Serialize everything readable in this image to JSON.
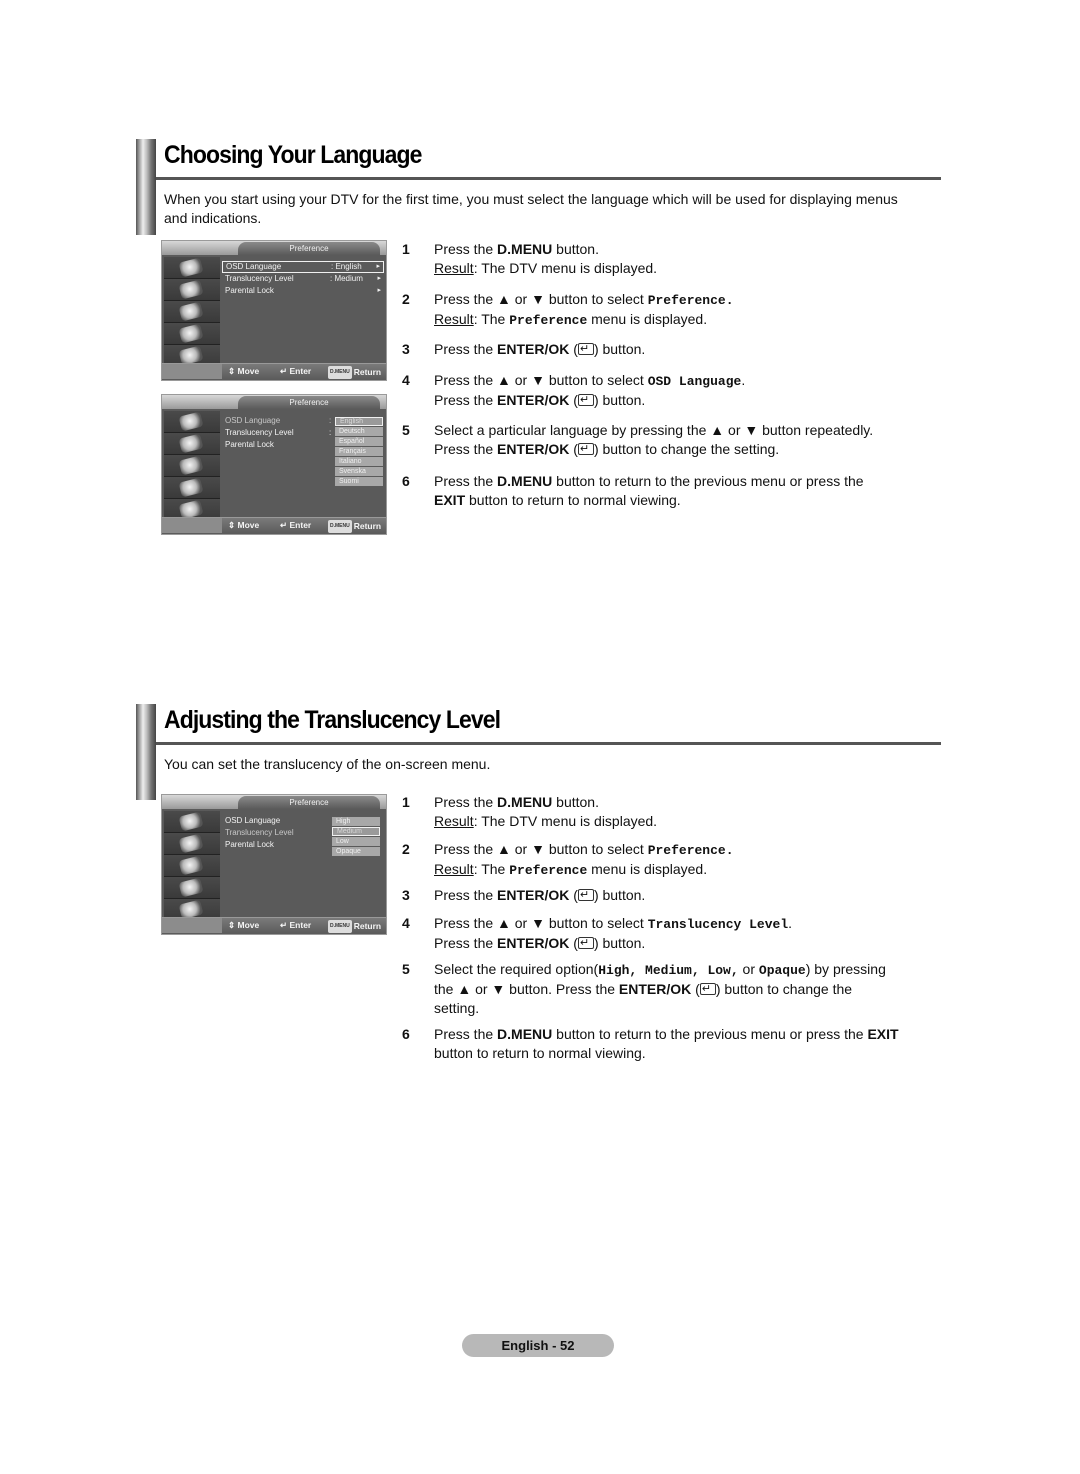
{
  "sections": [
    {
      "title": "Choosing Your Language",
      "intro": "When you start using your DTV for the first time, you must select the language which will be used for displaying menus and indications.",
      "osd_screens": [
        {
          "title": "Preference",
          "items": [
            {
              "label": "OSD Language",
              "value": ": English",
              "arrow": "▸",
              "selected": true
            },
            {
              "label": "Translucency Level",
              "value": ": Medium",
              "arrow": "▸",
              "selected": false
            },
            {
              "label": "Parental Lock",
              "value": "",
              "arrow": "▸",
              "selected": false
            }
          ],
          "footer": {
            "move": "Move",
            "enter": "Enter",
            "dmenu": "D.MENU",
            "return": "Return"
          }
        },
        {
          "title": "Preference",
          "items": [
            {
              "label": "OSD Language",
              "value": ":"
            },
            {
              "label": "Translucency Level",
              "value": ":"
            },
            {
              "label": "Parental Lock",
              "value": ""
            }
          ],
          "popup_options": [
            "English",
            "Deutsch",
            "Español",
            "Français",
            "Italiano",
            "Svenska",
            "Suomi"
          ],
          "popup_current": "English",
          "footer": {
            "move": "Move",
            "enter": "Enter",
            "dmenu": "D.MENU",
            "return": "Return"
          }
        }
      ],
      "steps": [
        {
          "num": "1",
          "l1a": "Press the ",
          "l1b": "D.MENU",
          "l1c": " button.",
          "result_label": "Result",
          "result_text": ":  The DTV menu is displayed."
        },
        {
          "num": "2",
          "l1a": "Press the ▲ or ▼ button to select ",
          "l1b": "Preference.",
          "result_label": "Result",
          "result_a": ":  The ",
          "result_b": "Preference",
          "result_c": " menu is displayed."
        },
        {
          "num": "3",
          "l1a": "Press the ",
          "l1b": "ENTER/OK",
          "l1c": " (",
          "l1d": ") button."
        },
        {
          "num": "4",
          "l1a": "Press the ▲ or ▼ button to select ",
          "l1b": "OSD Language",
          "l1c": ".",
          "l2a": "Press the ",
          "l2b": "ENTER/OK",
          "l2c": " (",
          "l2d": ") button."
        },
        {
          "num": "5",
          "l1a": "Select a particular language by pressing the ▲ or ▼ button repeatedly.",
          "l2a": "Press the ",
          "l2b": "ENTER/OK",
          "l2c": " (",
          "l2d": ") button to change the setting."
        },
        {
          "num": "6",
          "l1a": "Press the ",
          "l1b": "D.MENU",
          "l1c": " button to return to the previous menu or press the",
          "l2b": "EXIT",
          "l2c": " button to return to normal viewing."
        }
      ]
    },
    {
      "title": "Adjusting the Translucency Level",
      "intro": "You can set the translucency of the on-screen menu.",
      "osd_screens": [
        {
          "title": "Preference",
          "items": [
            {
              "label": "OSD Language"
            },
            {
              "label": "Translucency Level"
            },
            {
              "label": "Parental Lock"
            }
          ],
          "popup_options": [
            "High",
            "Medium",
            "Low",
            "Opaque"
          ],
          "popup_current": "Medium",
          "footer": {
            "move": "Move",
            "enter": "Enter",
            "dmenu": "D.MENU",
            "return": "Return"
          }
        }
      ],
      "steps": [
        {
          "num": "1",
          "l1a": "Press the ",
          "l1b": "D.MENU",
          "l1c": " button.",
          "result_label": "Result",
          "result_text": ":  The DTV menu is displayed."
        },
        {
          "num": "2",
          "l1a": "Press the ▲ or ▼ button to select ",
          "l1b": "Preference.",
          "result_label": "Result",
          "result_a": ":  The ",
          "result_b": "Preference",
          "result_c": " menu is displayed."
        },
        {
          "num": "3",
          "l1a": "Press the ",
          "l1b": "ENTER/OK",
          "l1c": " (",
          "l1d": ") button."
        },
        {
          "num": "4",
          "l1a": "Press the ▲ or ▼ button to select ",
          "l1b": "Translucency Level",
          "l1c": ".",
          "l2a": "Press the ",
          "l2b": "ENTER/OK",
          "l2c": " (",
          "l2d": ") button."
        },
        {
          "num": "5",
          "l1a": "Select the required option(",
          "o1": "High,",
          "o2": " Medium,",
          "o3": " Low,",
          "or": " or ",
          "o4": "Opaque",
          "l1c": ") by pressing",
          "l2a": "the ▲ or ▼ button. Press the ",
          "l2b": "ENTER/OK",
          "l2c": " (",
          "l2d": ") button to change the",
          "l3": "setting."
        },
        {
          "num": "6",
          "l1a": "Press the ",
          "l1b": "D.MENU",
          "l1c": " button to return to the previous menu or press the ",
          "l1d": "EXIT",
          "l2a": "button to return to normal viewing."
        }
      ]
    }
  ],
  "footer": {
    "page_label": "English - 52"
  }
}
